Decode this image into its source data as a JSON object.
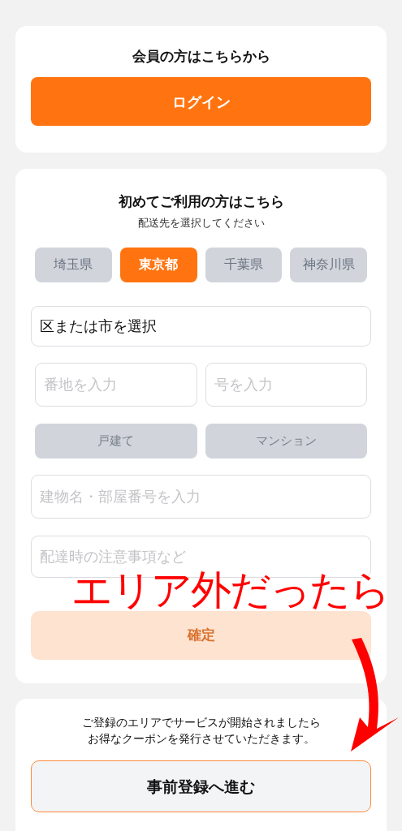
{
  "member_card": {
    "title": "会員の方はこちらから",
    "login_button": "ログイン"
  },
  "first_time_card": {
    "title": "初めてご利用の方はこちら",
    "subtitle": "配送先を選択してください",
    "prefectures": [
      {
        "label": "埼玉県",
        "selected": false
      },
      {
        "label": "東京都",
        "selected": true
      },
      {
        "label": "千葉県",
        "selected": false
      },
      {
        "label": "神奈川県",
        "selected": false
      }
    ],
    "city_select": {
      "value": "区または市を選択"
    },
    "address_fields": [
      {
        "placeholder": "番地を入力"
      },
      {
        "placeholder": "号を入力"
      }
    ],
    "house_types": [
      {
        "label": "戸建て",
        "selected": false
      },
      {
        "label": "マンション",
        "selected": false
      }
    ],
    "building_field": {
      "placeholder": "建物名・部屋番号を入力"
    },
    "notes_field": {
      "placeholder": "配達時の注意事項など"
    },
    "confirm_button": {
      "label": "確定",
      "disabled": true
    }
  },
  "pre_register_card": {
    "message_lines": [
      "ご登録のエリアでサービスが開始されましたら",
      "お得なクーポンを発行させていただきます。"
    ],
    "button": "事前登録へ進む"
  },
  "annotation": {
    "text": "エリア外だったら"
  }
}
